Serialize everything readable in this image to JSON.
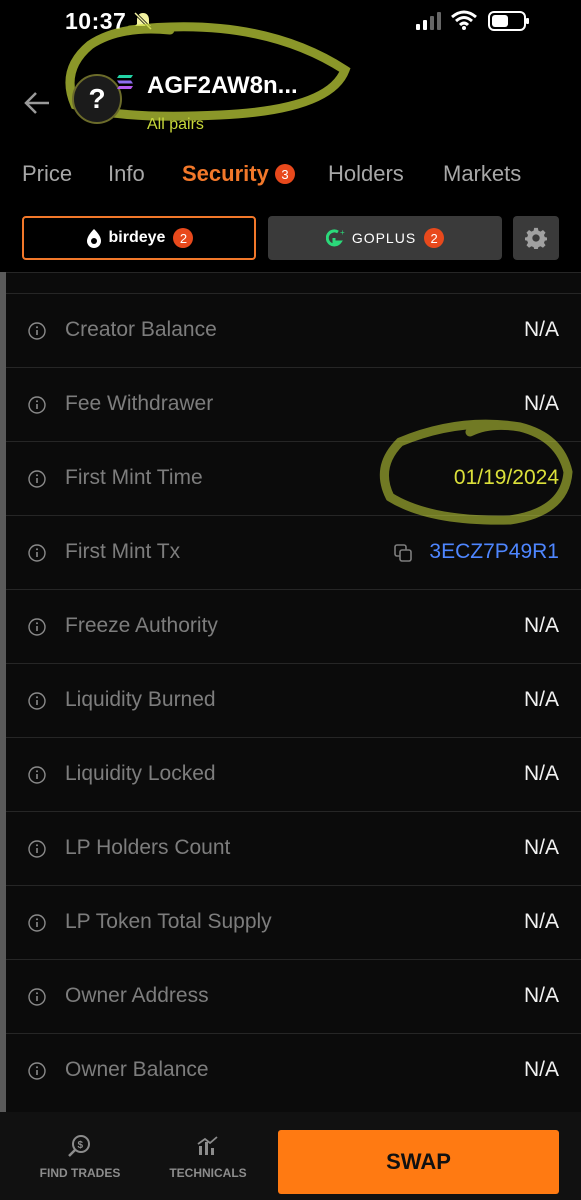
{
  "status_bar": {
    "time": "10:37"
  },
  "header": {
    "token_name": "AGF2AW8n...",
    "subtitle": "All pairs",
    "avatar_symbol": "?"
  },
  "tabs": [
    {
      "label": "Price"
    },
    {
      "label": "Info"
    },
    {
      "label": "Security",
      "badge": "3",
      "active": true
    },
    {
      "label": "Holders"
    },
    {
      "label": "Markets"
    }
  ],
  "providers": [
    {
      "label": "birdeye",
      "badge": "2",
      "active": true
    },
    {
      "label": "GOPLUS",
      "badge": "2",
      "active": false
    }
  ],
  "security_rows": [
    {
      "label": "Creator Balance",
      "value": "N/A"
    },
    {
      "label": "Fee Withdrawer",
      "value": "N/A"
    },
    {
      "label": "First Mint Time",
      "value": "01/19/2024"
    },
    {
      "label": "First Mint Tx",
      "value": "3ECZ7P49R1"
    },
    {
      "label": "Freeze Authority",
      "value": "N/A"
    },
    {
      "label": "Liquidity Burned",
      "value": "N/A"
    },
    {
      "label": "Liquidity Locked",
      "value": "N/A"
    },
    {
      "label": "LP Holders Count",
      "value": "N/A"
    },
    {
      "label": "LP Token Total Supply",
      "value": "N/A"
    },
    {
      "label": "Owner Address",
      "value": "N/A"
    },
    {
      "label": "Owner Balance",
      "value": "N/A"
    }
  ],
  "bottom_nav": {
    "find_trades": "FIND TRADES",
    "technicals": "TECHNICALS",
    "swap": "SWAP"
  },
  "colors": {
    "accent": "#f2782a",
    "highlight_marker": "#c6d73a",
    "link": "#4e86ff",
    "swap": "#ff7a12"
  }
}
